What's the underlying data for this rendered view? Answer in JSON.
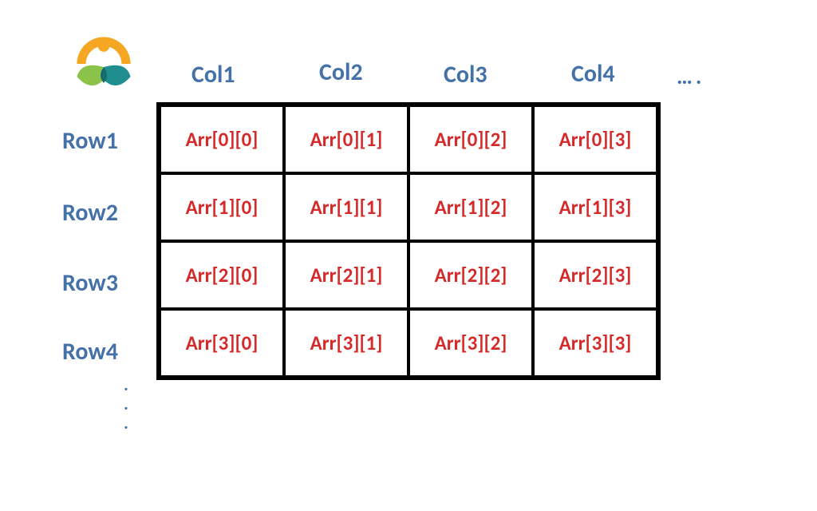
{
  "columns": [
    "Col1",
    "Col2",
    "Col3",
    "Col4"
  ],
  "rows": [
    "Row1",
    "Row2",
    "Row3",
    "Row4"
  ],
  "cells": [
    [
      "Arr[0][0]",
      "Arr[0][1]",
      "Arr[0][2]",
      "Arr[0][3]"
    ],
    [
      "Arr[1][0]",
      "Arr[1][1]",
      "Arr[1][2]",
      "Arr[1][3]"
    ],
    [
      "Arr[2][0]",
      "Arr[2][1]",
      "Arr[2][2]",
      "Arr[2][3]"
    ],
    [
      "Arr[3][0]",
      "Arr[3][1]",
      "Arr[3][2]",
      "Arr[3][3]"
    ]
  ],
  "col_ellipsis": "….",
  "row_dots": [
    ".",
    ".",
    "."
  ],
  "colors": {
    "header": "#4472a8",
    "cell_text": "#d62a2a",
    "border": "#000000"
  }
}
